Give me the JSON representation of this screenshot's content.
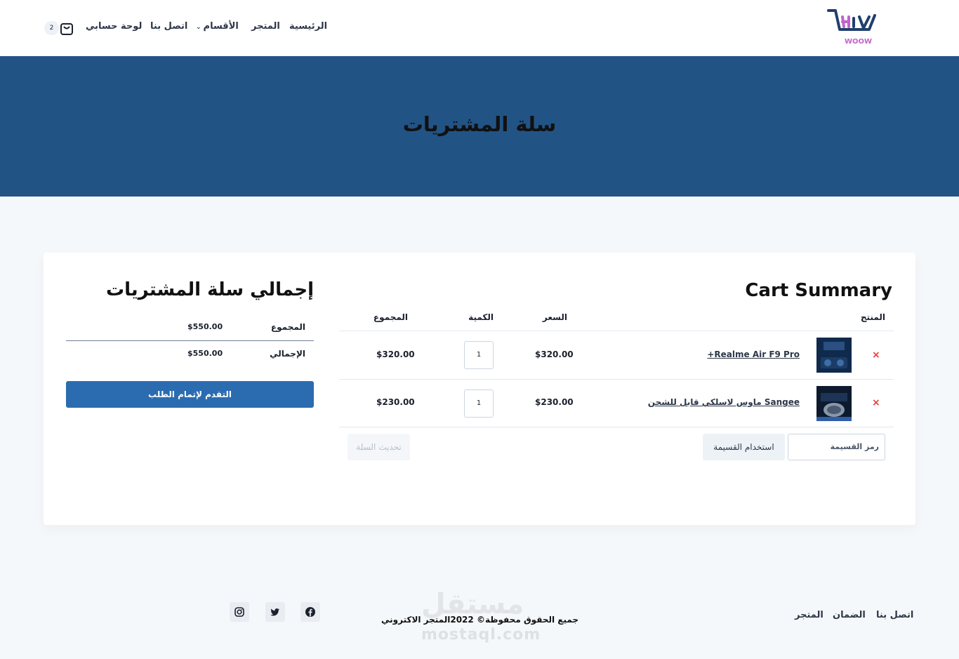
{
  "header": {
    "logo_text": "WOOW",
    "nav": {
      "home": "الرئيسية",
      "store": "المتجر",
      "categories": "الأقسام",
      "contact": "اتصل بنا",
      "account": "لوحة حسابي"
    },
    "cart_count": "2"
  },
  "hero": {
    "title": "سلة المشتريات"
  },
  "cart": {
    "title": "Cart Summary",
    "columns": {
      "product": "المنتج",
      "price": "السعر",
      "quantity": "الكمية",
      "total": "المجموع"
    },
    "remove_symbol": "×",
    "items": [
      {
        "name": "Realme Air F9 Pro+",
        "price": "$320.00",
        "quantity": "1",
        "total": "$320.00"
      },
      {
        "name": "Sangee ماوس لاسلكي قابل للشحن",
        "price": "$230.00",
        "quantity": "1",
        "total": "$230.00"
      }
    ],
    "coupon_placeholder": "رمز القسيمة",
    "apply_coupon": "استخدام القسيمة",
    "update_cart": "تحديث السلة"
  },
  "totals": {
    "title": "إجمالي سلة المشتريات",
    "subtotal_label": "المجموع",
    "subtotal_value": "$550.00",
    "total_label": "الإجمالي",
    "total_value": "$550.00",
    "checkout": "التقدم لإتمام الطلب"
  },
  "footer": {
    "links": {
      "contact": "اتصل بنا",
      "warranty": "الضمان",
      "store": "المتجر"
    },
    "copyright": "جميع الحقوق محفوظة© 2022المتجر الاكتروني",
    "social": [
      "facebook-icon",
      "twitter-icon",
      "instagram-icon"
    ]
  },
  "watermark": {
    "ar": "مستقل",
    "en": "mostaql.com"
  },
  "colors": {
    "hero": "#225385",
    "checkout": "#2b6cb0",
    "remove": "#e53e3e",
    "background": "#f5f8fb"
  }
}
